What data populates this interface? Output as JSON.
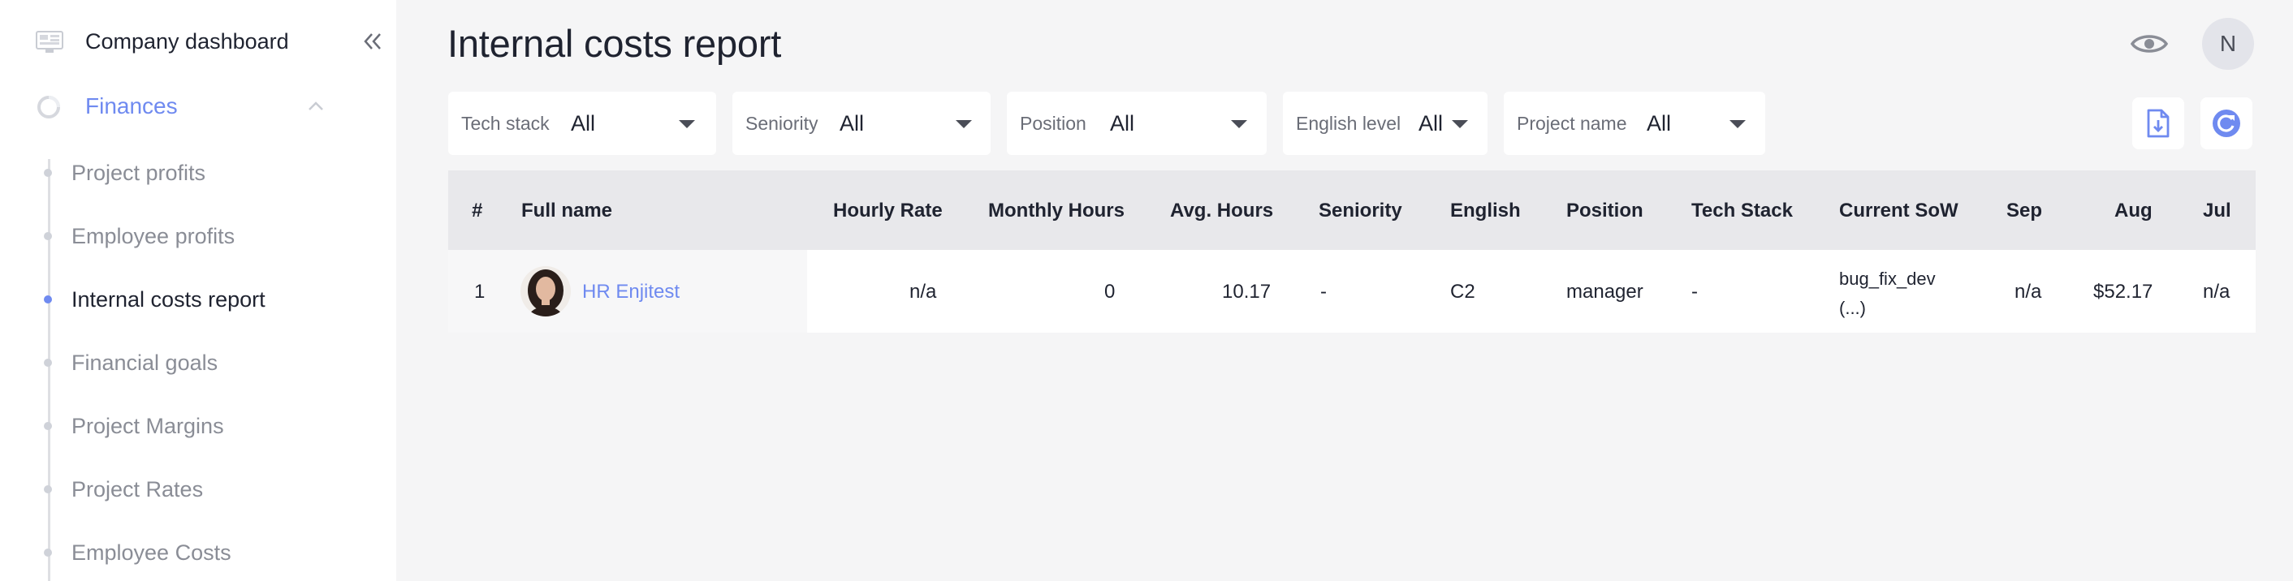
{
  "sidebar": {
    "dashboard_label": "Company dashboard",
    "section_label": "Finances",
    "items": [
      {
        "label": "Project profits",
        "active": false
      },
      {
        "label": "Employee profits",
        "active": false
      },
      {
        "label": "Internal costs report",
        "active": true
      },
      {
        "label": "Financial goals",
        "active": false
      },
      {
        "label": "Project Margins",
        "active": false
      },
      {
        "label": "Project Rates",
        "active": false
      },
      {
        "label": "Employee Costs",
        "active": false
      }
    ]
  },
  "header": {
    "title": "Internal costs report",
    "avatar_initial": "N"
  },
  "filters": [
    {
      "label": "Tech stack",
      "value": "All"
    },
    {
      "label": "Seniority",
      "value": "All"
    },
    {
      "label": "Position",
      "value": "All"
    },
    {
      "label": "English level",
      "value": "All"
    },
    {
      "label": "Project name",
      "value": "All"
    }
  ],
  "table": {
    "columns": [
      "#",
      "Full name",
      "Hourly Rate",
      "Monthly Hours",
      "Avg. Hours",
      "Seniority",
      "English",
      "Position",
      "Tech Stack",
      "Current SoW",
      "Sep",
      "Aug",
      "Jul"
    ],
    "rows": [
      {
        "index": "1",
        "full_name": "HR Enjitest",
        "hourly_rate": "n/a",
        "monthly_hours": "0",
        "avg_hours": "10.17",
        "seniority": "-",
        "english": "C2",
        "position": "manager",
        "tech_stack": "-",
        "current_sow_line1": "bug_fix_dev",
        "current_sow_line2": "(...)",
        "sep": "n/a",
        "aug": "$52.17",
        "jul": "n/a"
      }
    ]
  },
  "colors": {
    "accent": "#6f8af0",
    "background": "#f5f5f6",
    "header_row": "#e8e8eb"
  }
}
